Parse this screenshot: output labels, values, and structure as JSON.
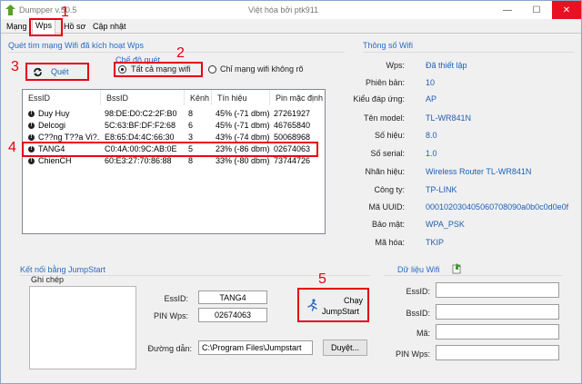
{
  "window": {
    "title": "Dumpper v.50.5",
    "credit": "Việt hóa bởi ptk911",
    "controls": {
      "minimize": "—",
      "maximize": "☐",
      "close": "✕"
    }
  },
  "tabs": [
    "Mạng",
    "Wps",
    "Hồ sơ",
    "Cập nhật"
  ],
  "annotations": [
    "1",
    "2",
    "3",
    "4",
    "5"
  ],
  "scan": {
    "section_title": "Quét tìm mạng Wifi đã kích hoạt Wps",
    "scan_button": "Quét",
    "mode_title": "Chế độ quét",
    "mode_all": "Tất cả mạng wifi",
    "mode_unknown": "Chỉ mạng wifi không rõ"
  },
  "network_list": {
    "columns": [
      "EssID",
      "BssID",
      "Kênh",
      "Tín hiệu",
      "Pin mặc định"
    ],
    "rows": [
      [
        "Duy Huy",
        "98:DE:D0:C2:2F:B0",
        "8",
        "45% (-71 dbm)",
        "27261927"
      ],
      [
        "Delcogi",
        "5C:63:BF:DF:F2:68",
        "6",
        "45% (-71 dbm)",
        "46765840"
      ],
      [
        "C??ng T??a Vi?...",
        "E8:65:D4:4C:66:30",
        "3",
        "43% (-74 dbm)",
        "50068968"
      ],
      [
        "TANG4",
        "C0:4A:00:9C:AB:0E",
        "5",
        "23% (-86 dbm)",
        "02674063"
      ],
      [
        "ChienCH",
        "60:E3:27:70:86:88",
        "8",
        "33% (-80 dbm)",
        "73744726"
      ]
    ]
  },
  "wifi_info": {
    "title": "Thông số Wifi",
    "fields": [
      {
        "label": "Wps:",
        "value": "Đã thiết lập"
      },
      {
        "label": "Phiên bản:",
        "value": "10"
      },
      {
        "label": "Kiểu đáp ứng:",
        "value": "AP"
      },
      {
        "label": "Tên model:",
        "value": "TL-WR841N"
      },
      {
        "label": "Số hiệu:",
        "value": "8.0"
      },
      {
        "label": "Số serial:",
        "value": "1.0"
      },
      {
        "label": "Nhãn hiệu:",
        "value": "Wireless Router TL-WR841N"
      },
      {
        "label": "Công ty:",
        "value": "TP-LINK"
      },
      {
        "label": "Mã UUID:",
        "value": "000102030405060708090a0b0c0d0e0f"
      },
      {
        "label": "Bảo mật:",
        "value": "WPA_PSK"
      },
      {
        "label": "Mã hóa:",
        "value": "TKIP"
      }
    ]
  },
  "jumpstart": {
    "title": "Kết nối bằng JumpStart",
    "notes_label": "Ghi chép",
    "essid_label": "EssID:",
    "essid_value": "TANG4",
    "pin_label": "PIN Wps:",
    "pin_value": "02674063",
    "run_button_line1": "Chạy",
    "run_button_line2": "JumpStart",
    "path_label": "Đường dẫn:",
    "path_value": "C:\\Program Files\\Jumpstart",
    "browse_button": "Duyệt..."
  },
  "wifi_data": {
    "title": "Dữ liệu Wifi",
    "essid_label": "EssID:",
    "bssid_label": "BssID:",
    "key_label": "Mã:",
    "pin_label": "PIN Wps:"
  }
}
